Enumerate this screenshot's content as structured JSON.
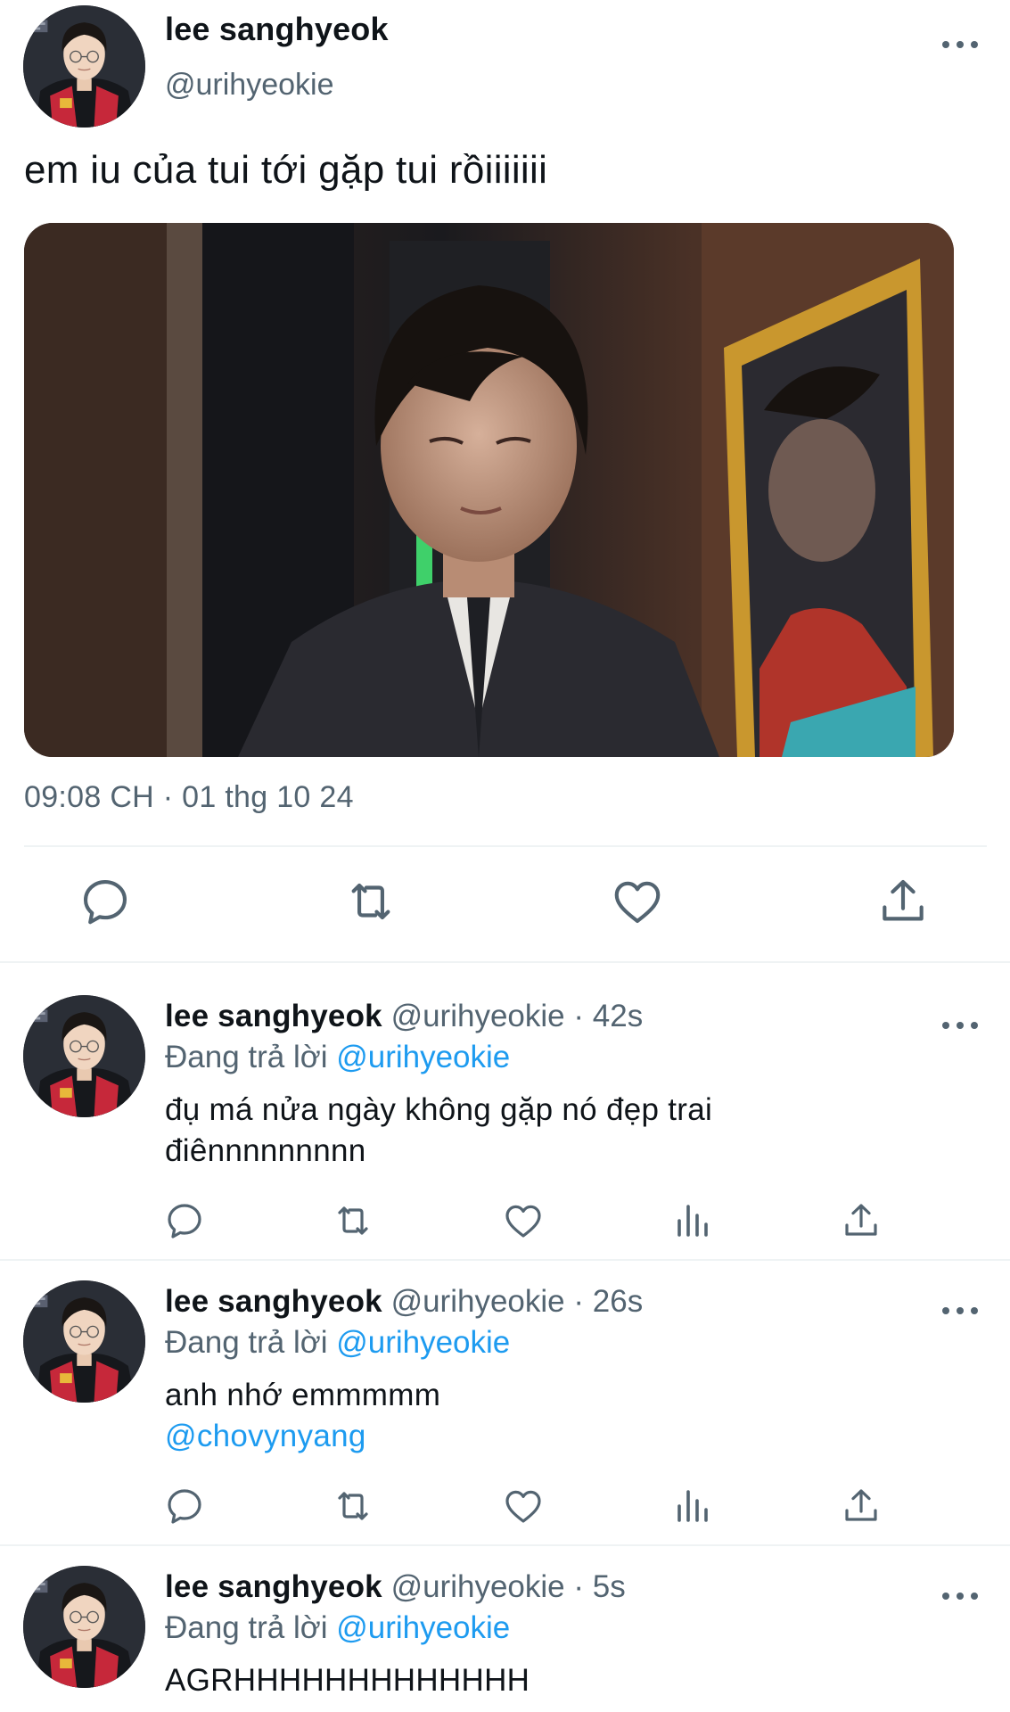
{
  "main_tweet": {
    "name": "lee sanghyeok",
    "handle": "@urihyeokie",
    "text": "em iu của tui tới gặp tui rồiiiiiii",
    "timestamp": "09:08 CH · 01 thg 10 24",
    "actions": [
      "reply-icon",
      "retweet-icon",
      "like-icon",
      "share-icon"
    ]
  },
  "replies": [
    {
      "name": "lee sanghyeok",
      "handle": "@urihyeokie",
      "separator": "·",
      "time": "42s",
      "replying_prefix": "Đang trả lời",
      "replying_to": "@urihyeokie",
      "line1": "đụ má nửa ngày không gặp nó đẹp trai",
      "line2": "điênnnnnnnnn"
    },
    {
      "name": "lee sanghyeok",
      "handle": "@urihyeokie",
      "separator": "·",
      "time": "26s",
      "replying_prefix": "Đang trả lời",
      "replying_to": "@urihyeokie",
      "line1": "anh nhớ emmmmm",
      "mention": "@chovynyang"
    },
    {
      "name": "lee sanghyeok",
      "handle": "@urihyeokie",
      "separator": "·",
      "time": "5s",
      "replying_prefix": "Đang trả lời",
      "replying_to": "@urihyeokie",
      "line1": "AGRHHHHHHHHHHHHH"
    }
  ],
  "reply_actions": [
    "reply-icon",
    "retweet-icon",
    "like-icon",
    "views-icon",
    "share-icon"
  ],
  "colors": {
    "text": "#0f1419",
    "secondary": "#536471",
    "link": "#1d9bf0",
    "divider": "#eff3f4"
  }
}
